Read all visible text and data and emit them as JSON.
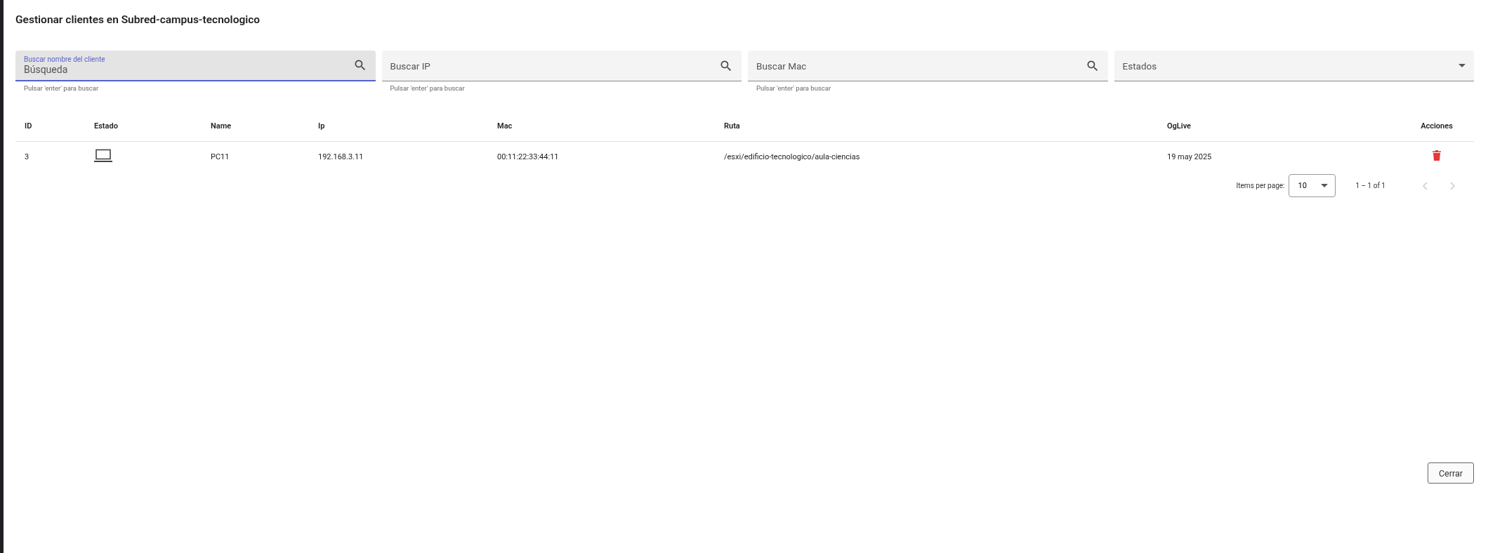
{
  "dialog": {
    "title": "Gestionar clientes en Subred-campus-tecnologico"
  },
  "filters": [
    {
      "kind": "search",
      "label": "Buscar nombre del cliente",
      "placeholder": "Búsqueda",
      "focused": true,
      "hint": "Pulsar 'enter' para buscar"
    },
    {
      "kind": "search",
      "label": "Buscar IP",
      "focused": false,
      "hint": "Pulsar 'enter' para buscar"
    },
    {
      "kind": "search",
      "label": "Buscar Mac",
      "focused": false,
      "hint": "Pulsar 'enter' para buscar"
    },
    {
      "kind": "select",
      "label": "Estados",
      "focused": false
    }
  ],
  "table": {
    "columns": [
      "ID",
      "Estado",
      "Name",
      "Ip",
      "Mac",
      "Ruta",
      "OgLive",
      "Acciones"
    ],
    "rows": [
      {
        "id": "3",
        "name": "PC11",
        "ip": "192.168.3.11",
        "mac": "00:11:22:33:44:11",
        "ruta": "/esxi/edificio-tecnologico/aula-ciencias",
        "oglive": "19 may 2025"
      }
    ]
  },
  "paginator": {
    "label": "Items per page:",
    "page_size": "10",
    "range": "1 – 1 of 1",
    "prev_disabled": true,
    "next_disabled": true
  },
  "buttons": [
    "Cerrar"
  ]
}
